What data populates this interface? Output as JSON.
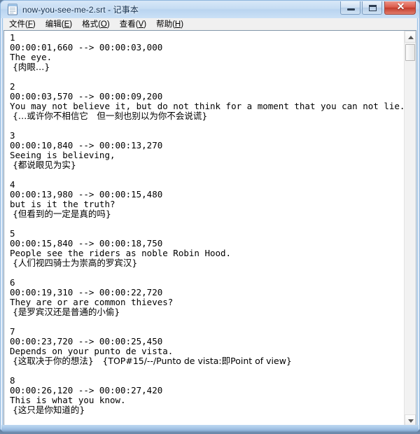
{
  "window": {
    "title": "now-you-see-me-2.srt - 记事本",
    "icon": "notepad-icon",
    "buttons": {
      "minimize": "—",
      "maximize": "❐",
      "close": "✕"
    }
  },
  "menubar": [
    {
      "name": "file",
      "label": "文件",
      "accel": "F"
    },
    {
      "name": "edit",
      "label": "编辑",
      "accel": "E"
    },
    {
      "name": "format",
      "label": "格式",
      "accel": "O"
    },
    {
      "name": "view",
      "label": "查看",
      "accel": "V"
    },
    {
      "name": "help",
      "label": "帮助",
      "accel": "H"
    }
  ],
  "editor": {
    "lines": [
      {
        "type": "mono",
        "text": "1"
      },
      {
        "type": "mono",
        "text": "00:00:01,660 --> 00:00:03,000"
      },
      {
        "type": "mono",
        "text": "The eye."
      },
      {
        "type": "cjk",
        "text": " {肉眼…}"
      },
      {
        "type": "blank",
        "text": ""
      },
      {
        "type": "mono",
        "text": "2"
      },
      {
        "type": "mono",
        "text": "00:00:03,570 --> 00:00:09,200"
      },
      {
        "type": "mono",
        "text": "You may not believe it, but do not think for a moment that you can not lie."
      },
      {
        "type": "cjk",
        "text": " {…或许你不相信它　但一刻也别以为你不会说谎}"
      },
      {
        "type": "blank",
        "text": ""
      },
      {
        "type": "mono",
        "text": "3"
      },
      {
        "type": "mono",
        "text": "00:00:10,840 --> 00:00:13,270"
      },
      {
        "type": "mono",
        "text": "Seeing is believing,"
      },
      {
        "type": "cjk",
        "text": " {都说眼见为实}"
      },
      {
        "type": "blank",
        "text": ""
      },
      {
        "type": "mono",
        "text": "4"
      },
      {
        "type": "mono",
        "text": "00:00:13,980 --> 00:00:15,480"
      },
      {
        "type": "mono",
        "text": "but is it the truth?"
      },
      {
        "type": "cjk",
        "text": " {但看到的一定是真的吗}"
      },
      {
        "type": "blank",
        "text": ""
      },
      {
        "type": "mono",
        "text": "5"
      },
      {
        "type": "mono",
        "text": "00:00:15,840 --> 00:00:18,750"
      },
      {
        "type": "mono",
        "text": "People see the riders as noble Robin Hood."
      },
      {
        "type": "cjk",
        "text": " {人们视四骑士为崇高的罗宾汉}"
      },
      {
        "type": "blank",
        "text": ""
      },
      {
        "type": "mono",
        "text": "6"
      },
      {
        "type": "mono",
        "text": "00:00:19,310 --> 00:00:22,720"
      },
      {
        "type": "mono",
        "text": "They are or are common thieves?"
      },
      {
        "type": "cjk",
        "text": " {是罗宾汉还是普通的小偷}"
      },
      {
        "type": "blank",
        "text": ""
      },
      {
        "type": "mono",
        "text": "7"
      },
      {
        "type": "mono",
        "text": "00:00:23,720 --> 00:00:25,450"
      },
      {
        "type": "mono",
        "text": "Depends on your punto de vista."
      },
      {
        "type": "cjk",
        "text": " {这取决于你的想法}　{TOP#15/--/Punto de vista:即Point of view}"
      },
      {
        "type": "blank",
        "text": ""
      },
      {
        "type": "mono",
        "text": "8"
      },
      {
        "type": "mono",
        "text": "00:00:26,120 --> 00:00:27,420"
      },
      {
        "type": "mono",
        "text": "This is what you know."
      },
      {
        "type": "cjk",
        "text": " {这只是你知道的}"
      }
    ]
  },
  "scrollbar": {
    "up_arrow": "scroll-up-arrow",
    "down_arrow": "scroll-down-arrow",
    "thumb": "scroll-thumb"
  }
}
